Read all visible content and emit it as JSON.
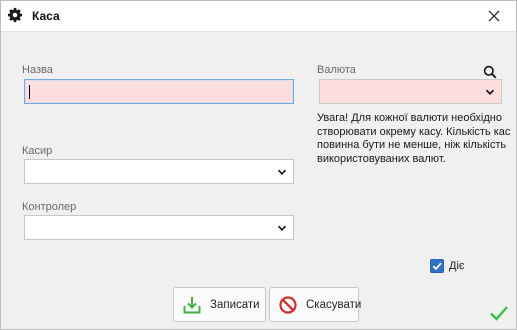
{
  "window": {
    "title": "Каса"
  },
  "form": {
    "name": {
      "label": "Назва",
      "value": ""
    },
    "currency": {
      "label": "Валюта",
      "value": ""
    },
    "cashier": {
      "label": "Касир",
      "value": ""
    },
    "controller": {
      "label": "Контролер",
      "value": ""
    },
    "note": "Увага! Для кожної валюти необхідно створювати окрему касу. Кількість кас повинна бути не менше, ніж кількість використовуваних валют.",
    "active": {
      "label": "Діє",
      "checked": true
    }
  },
  "buttons": {
    "save": "Записати",
    "cancel": "Скасувати"
  },
  "colors": {
    "required_bg": "#fcdede",
    "checkbox": "#2f73c8",
    "ok_green": "#3bbf4a",
    "save_green": "#43b049",
    "cancel_red": "#d0312d"
  }
}
